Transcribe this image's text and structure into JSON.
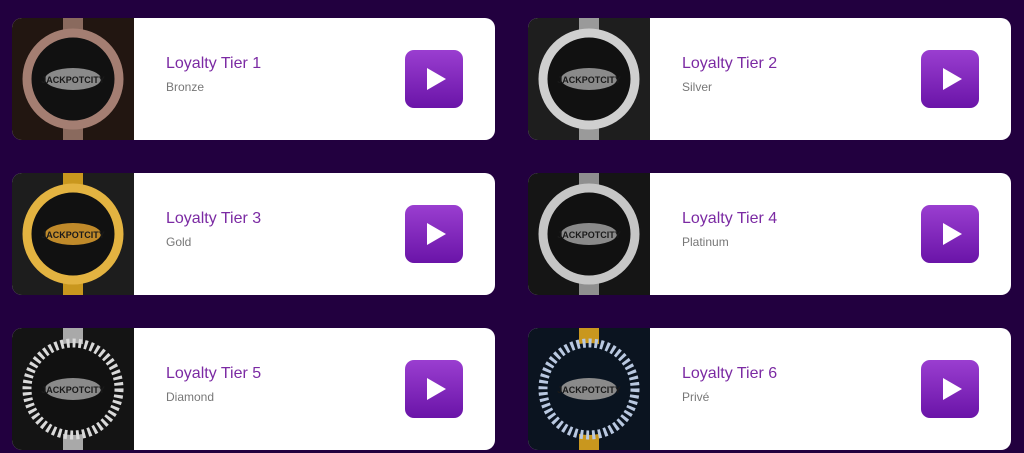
{
  "tiers": [
    {
      "title": "Loyalty Tier 1",
      "subtitle": "Bronze",
      "logo_text": "JACKPOTCITY",
      "band": "#8a6a5e",
      "ring": "#a47e72",
      "bg": "#221611"
    },
    {
      "title": "Loyalty Tier 2",
      "subtitle": "Silver",
      "logo_text": "JACKPOTCITY",
      "band": "#9a9a9a",
      "ring": "#cfcfcf",
      "bg": "#1e1e1e"
    },
    {
      "title": "Loyalty Tier 3",
      "subtitle": "Gold",
      "logo_text": "JACKPOTCITY",
      "band": "#c9971e",
      "ring": "#e3b341",
      "bg": "#1d1d1d"
    },
    {
      "title": "Loyalty Tier 4",
      "subtitle": "Platinum",
      "logo_text": "JACKPOTCITY",
      "band": "#8f8f8f",
      "ring": "#c6c6c6",
      "bg": "#151515"
    },
    {
      "title": "Loyalty Tier 5",
      "subtitle": "Diamond",
      "logo_text": "JACKPOTCITY",
      "band": "#a9a9a9",
      "ring": "#d9d9d9",
      "bg": "#141414"
    },
    {
      "title": "Loyalty Tier 6",
      "subtitle": "Privé",
      "logo_text": "JACKPOTCITY",
      "band": "#c9971e",
      "ring": "#b9c8e0",
      "bg": "#0b1420"
    }
  ],
  "play_icon": "play-icon",
  "colors": {
    "page_bg": "#22003f",
    "title": "#7b2aa3",
    "subtitle": "#777777",
    "play_top": "#9a3ed0",
    "play_bottom": "#6a14a8"
  }
}
